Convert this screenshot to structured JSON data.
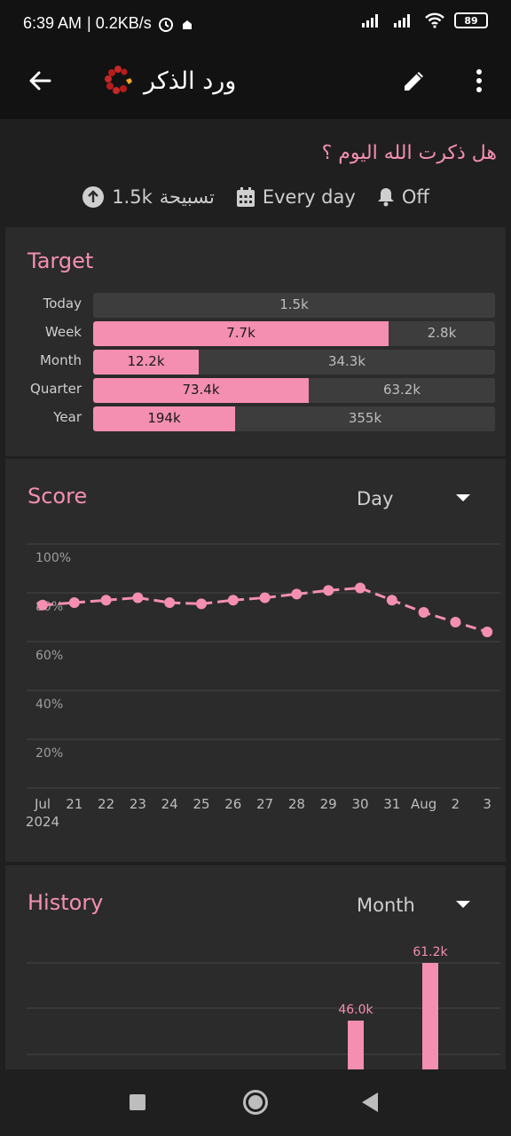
{
  "status_bar": {
    "time": "6:39 AM",
    "speed": "| 0.2KB/s",
    "battery": "89"
  },
  "app_bar": {
    "title": "ورد الذكر"
  },
  "habit": {
    "question": "هل ذكرت الله اليوم ؟",
    "target_value": "1.5k",
    "target_unit": "تسبيحة",
    "frequency": "Every day",
    "reminder": "Off"
  },
  "target": {
    "title": "Target",
    "rows": [
      {
        "label": "Today",
        "done": "",
        "remaining": "1.5k",
        "progress": 0
      },
      {
        "label": "Week",
        "done": "7.7k",
        "remaining": "2.8k",
        "progress": 0.735
      },
      {
        "label": "Month",
        "done": "12.2k",
        "remaining": "34.3k",
        "progress": 0.262
      },
      {
        "label": "Quarter",
        "done": "73.4k",
        "remaining": "63.2k",
        "progress": 0.537
      },
      {
        "label": "Year",
        "done": "194k",
        "remaining": "355k",
        "progress": 0.353
      }
    ]
  },
  "score": {
    "title": "Score",
    "period": "Day"
  },
  "history": {
    "title": "History",
    "period": "Month"
  },
  "colors": {
    "accent": "#f48fb1",
    "card": "#2b2b2b",
    "background": "#1f1f1f"
  },
  "chart_data": [
    {
      "type": "line",
      "categories": [
        "Jul",
        "21",
        "22",
        "23",
        "24",
        "25",
        "26",
        "27",
        "28",
        "29",
        "30",
        "31",
        "Aug",
        "2",
        "3"
      ],
      "x_sublabel": "2024",
      "y_ticks": [
        "100%",
        "80%",
        "60%",
        "40%",
        "20%"
      ],
      "ylim": [
        0,
        100
      ],
      "values": [
        75,
        76,
        77,
        78,
        76,
        75.5,
        77,
        78,
        79.5,
        81,
        82,
        77,
        72,
        68,
        64
      ],
      "grid": true
    },
    {
      "type": "bar",
      "data_labels": [
        "46.0k",
        "61.2k"
      ],
      "values": [
        46.0,
        61.2
      ]
    }
  ]
}
